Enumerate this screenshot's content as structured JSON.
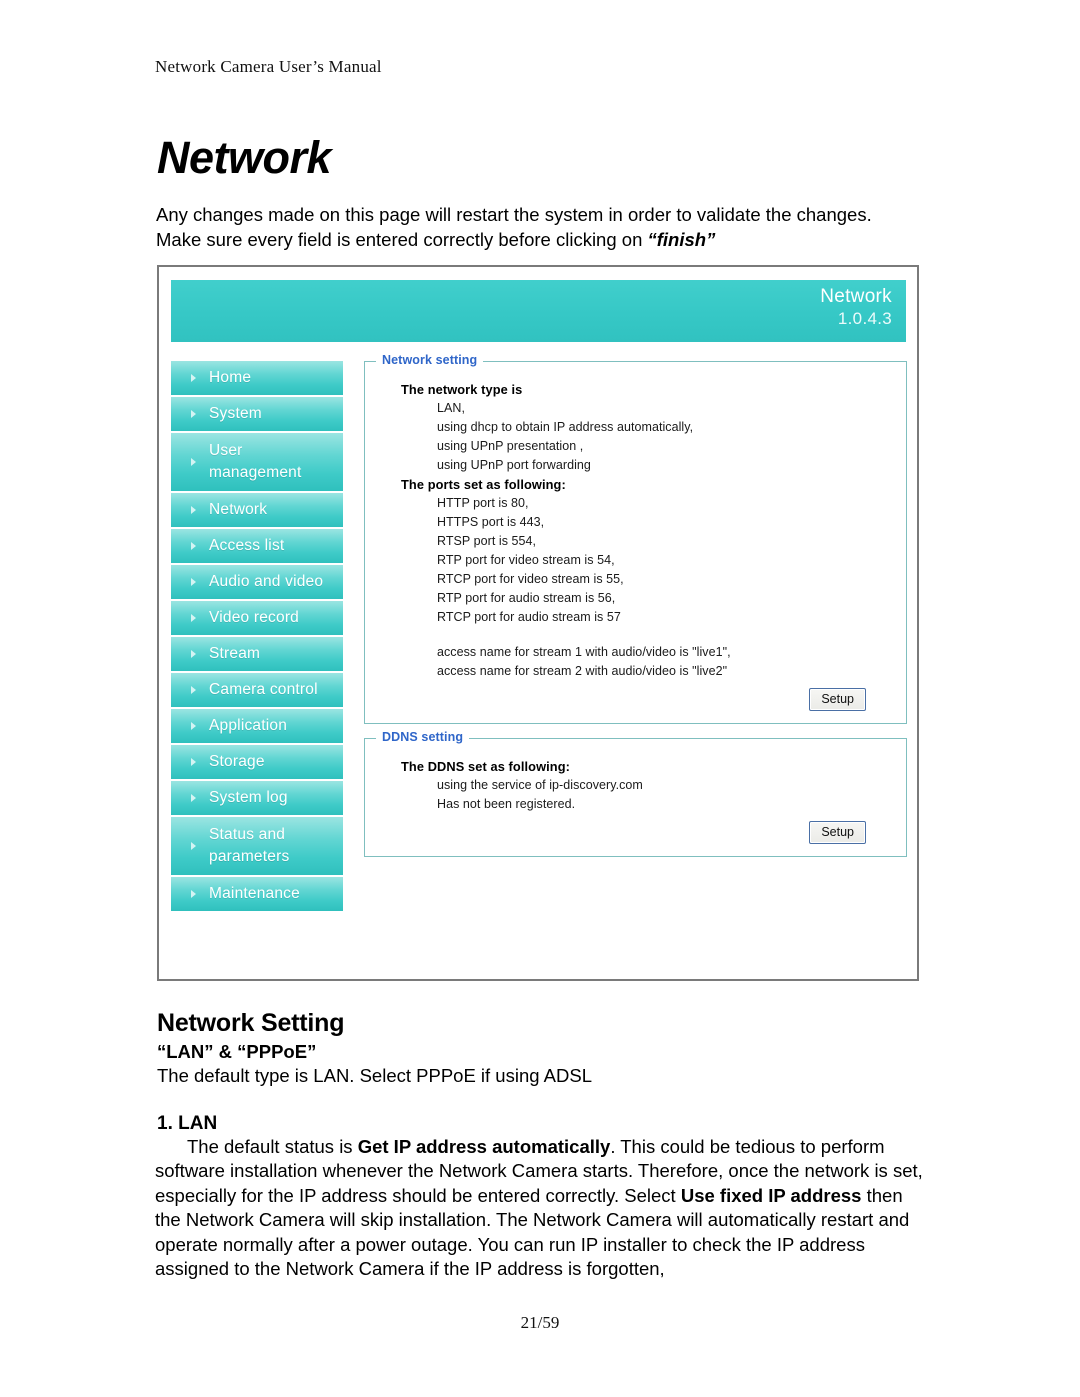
{
  "document": {
    "running_header": "Network Camera User’s Manual",
    "chapter_title": "Network",
    "intro_line1": "Any changes made on this page will restart the system in order to validate the changes.",
    "intro_line2_pre": "Make sure every field is entered correctly before clicking on ",
    "intro_line2_em": "“finish”",
    "page_number": "21/59"
  },
  "screenshot": {
    "banner": {
      "title": "Network",
      "version": "1.0.4.3",
      "color": "#36c8c6"
    },
    "sidebar": {
      "items": [
        {
          "label": "Home",
          "two_line": false
        },
        {
          "label": "System",
          "two_line": false
        },
        {
          "label": "User\nmanagement",
          "two_line": true
        },
        {
          "label": "Network",
          "two_line": false
        },
        {
          "label": "Access list",
          "two_line": false
        },
        {
          "label": "Audio and video",
          "two_line": false
        },
        {
          "label": "Video record",
          "two_line": false
        },
        {
          "label": "Stream",
          "two_line": false
        },
        {
          "label": "Camera control",
          "two_line": false
        },
        {
          "label": "Application",
          "two_line": false
        },
        {
          "label": "Storage",
          "two_line": false
        },
        {
          "label": "System log",
          "two_line": false
        },
        {
          "label": "Status and\nparameters",
          "two_line": true
        },
        {
          "label": "Maintenance",
          "two_line": false
        }
      ]
    },
    "panels": [
      {
        "legend": "Network setting",
        "groups": [
          {
            "title": "The network type is",
            "lines": [
              "LAN,",
              "using dhcp to obtain IP address automatically,",
              "using UPnP presentation ,",
              "using UPnP port forwarding"
            ]
          },
          {
            "title": "The ports set as following:",
            "lines": [
              "HTTP port is 80,",
              "HTTPS port is 443,",
              "RTSP port is 554,",
              "RTP port for video stream is 54,",
              "RTCP port for video stream is 55,",
              "RTP port for audio stream is 56,",
              "RTCP port for audio stream is 57"
            ]
          },
          {
            "title": "",
            "lines": [
              "access name for stream 1 with audio/video is \"live1\",",
              "access name for stream 2 with audio/video is \"live2\""
            ]
          }
        ],
        "button": "Setup"
      },
      {
        "legend": "DDNS setting",
        "groups": [
          {
            "title": "The DDNS set as following:",
            "lines": [
              "using the service of ip-discovery.com",
              "Has not been registered."
            ]
          }
        ],
        "button": "Setup"
      }
    ]
  },
  "sections": {
    "heading": "Network Setting",
    "subheading": "“LAN” & “PPPoE”",
    "para1": "The default type is LAN. Select PPPoE if using ADSL",
    "numbered_heading": "1. LAN",
    "body": {
      "t1": "The default status is ",
      "b1": "Get IP address automatically",
      "t2": ". This could be tedious to perform software installation whenever the Network Camera starts. Therefore, once the network is set, especially for the IP address should be entered correctly. Select ",
      "b2": "Use fixed IP address",
      "t3": " then the Network Camera will skip installation. The Network Camera will automatically restart and operate normally after a power outage. You can run IP installer to check the IP address assigned to the Network Camera if the IP address is forgotten,"
    }
  }
}
